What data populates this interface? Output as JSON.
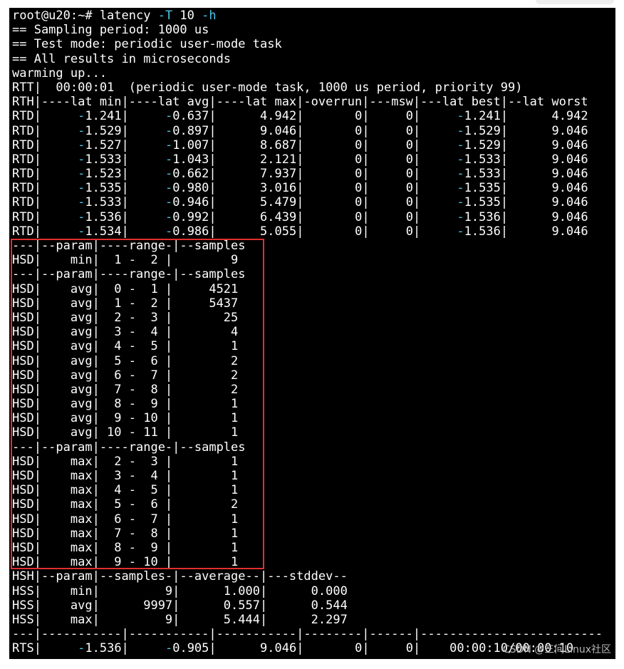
{
  "terminal": {
    "lines": [
      [
        {
          "t": "root@u20:~# latency "
        },
        {
          "t": "-T",
          "c": "cyan"
        },
        {
          "t": " 10 "
        },
        {
          "t": "-h",
          "c": "cyan"
        }
      ],
      [
        {
          "t": "== Sampling period: 1000 us"
        }
      ],
      [
        {
          "t": "== Test mode: periodic user-mode task"
        }
      ],
      [
        {
          "t": "== All results in microseconds"
        }
      ],
      [
        {
          "t": "warming up..."
        }
      ],
      [
        {
          "t": "RTT|  00:00:01  (periodic user-mode task, 1000 us period, priority 99)"
        }
      ],
      [
        {
          "t": "RTH|----lat min|----lat avg|----lat max|-overrun|---msw|---lat best|--lat worst"
        }
      ],
      [
        {
          "t": "RTD|     "
        },
        {
          "t": "-",
          "c": "cyan"
        },
        {
          "t": "1.241|     "
        },
        {
          "t": "-",
          "c": "cyan"
        },
        {
          "t": "0.637|      4.942|       0|     0|     "
        },
        {
          "t": "-",
          "c": "cyan"
        },
        {
          "t": "1.241|      4.942"
        }
      ],
      [
        {
          "t": "RTD|     "
        },
        {
          "t": "-",
          "c": "cyan"
        },
        {
          "t": "1.529|     "
        },
        {
          "t": "-",
          "c": "cyan"
        },
        {
          "t": "0.897|      9.046|       0|     0|     "
        },
        {
          "t": "-",
          "c": "cyan"
        },
        {
          "t": "1.529|      9.046"
        }
      ],
      [
        {
          "t": "RTD|     "
        },
        {
          "t": "-",
          "c": "cyan"
        },
        {
          "t": "1.527|     "
        },
        {
          "t": "-",
          "c": "cyan"
        },
        {
          "t": "1.007|      8.687|       0|     0|     "
        },
        {
          "t": "-",
          "c": "cyan"
        },
        {
          "t": "1.529|      9.046"
        }
      ],
      [
        {
          "t": "RTD|     "
        },
        {
          "t": "-",
          "c": "cyan"
        },
        {
          "t": "1.533|     "
        },
        {
          "t": "-",
          "c": "cyan"
        },
        {
          "t": "1.043|      2.121|       0|     0|     "
        },
        {
          "t": "-",
          "c": "cyan"
        },
        {
          "t": "1.533|      9.046"
        }
      ],
      [
        {
          "t": "RTD|     "
        },
        {
          "t": "-",
          "c": "cyan"
        },
        {
          "t": "1.523|     "
        },
        {
          "t": "-",
          "c": "cyan"
        },
        {
          "t": "0.662|      7.937|       0|     0|     "
        },
        {
          "t": "-",
          "c": "cyan"
        },
        {
          "t": "1.533|      9.046"
        }
      ],
      [
        {
          "t": "RTD|     "
        },
        {
          "t": "-",
          "c": "cyan"
        },
        {
          "t": "1.535|     "
        },
        {
          "t": "-",
          "c": "cyan"
        },
        {
          "t": "0.980|      3.016|       0|     0|     "
        },
        {
          "t": "-",
          "c": "cyan"
        },
        {
          "t": "1.535|      9.046"
        }
      ],
      [
        {
          "t": "RTD|     "
        },
        {
          "t": "-",
          "c": "cyan"
        },
        {
          "t": "1.533|     "
        },
        {
          "t": "-",
          "c": "cyan"
        },
        {
          "t": "0.946|      5.479|       0|     0|     "
        },
        {
          "t": "-",
          "c": "cyan"
        },
        {
          "t": "1.535|      9.046"
        }
      ],
      [
        {
          "t": "RTD|     "
        },
        {
          "t": "-",
          "c": "cyan"
        },
        {
          "t": "1.536|     "
        },
        {
          "t": "-",
          "c": "cyan"
        },
        {
          "t": "0.992|      6.439|       0|     0|     "
        },
        {
          "t": "-",
          "c": "cyan"
        },
        {
          "t": "1.536|      9.046"
        }
      ],
      [
        {
          "t": "RTD|     "
        },
        {
          "t": "-",
          "c": "cyan"
        },
        {
          "t": "1.534|     "
        },
        {
          "t": "-",
          "c": "cyan"
        },
        {
          "t": "0.986|      5.055|       0|     0|     "
        },
        {
          "t": "-",
          "c": "cyan"
        },
        {
          "t": "1.536|      9.046"
        }
      ],
      [
        {
          "t": "---|--param|----range-|--samples"
        }
      ],
      [
        {
          "t": "HSD|    min|  1 -  2 |        9"
        }
      ],
      [
        {
          "t": "---|--param|----range-|--samples"
        }
      ],
      [
        {
          "t": "HSD|    avg|  0 -  1 |     4521"
        }
      ],
      [
        {
          "t": "HSD|    avg|  1 -  2 |     5437"
        }
      ],
      [
        {
          "t": "HSD|    avg|  2 -  3 |       25"
        }
      ],
      [
        {
          "t": "HSD|    avg|  3 -  4 |        4"
        }
      ],
      [
        {
          "t": "HSD|    avg|  4 -  5 |        1"
        }
      ],
      [
        {
          "t": "HSD|    avg|  5 -  6 |        2"
        }
      ],
      [
        {
          "t": "HSD|    avg|  6 -  7 |        2"
        }
      ],
      [
        {
          "t": "HSD|    avg|  7 -  8 |        2"
        }
      ],
      [
        {
          "t": "HSD|    avg|  8 -  9 |        1"
        }
      ],
      [
        {
          "t": "HSD|    avg|  9 - 10 |        1"
        }
      ],
      [
        {
          "t": "HSD|    avg| 10 - 11 |        1"
        }
      ],
      [
        {
          "t": "---|--param|----range-|--samples"
        }
      ],
      [
        {
          "t": "HSD|    max|  2 -  3 |        1"
        }
      ],
      [
        {
          "t": "HSD|    max|  3 -  4 |        1"
        }
      ],
      [
        {
          "t": "HSD|    max|  4 -  5 |        1"
        }
      ],
      [
        {
          "t": "HSD|    max|  5 -  6 |        2"
        }
      ],
      [
        {
          "t": "HSD|    max|  6 -  7 |        1"
        }
      ],
      [
        {
          "t": "HSD|    max|  7 -  8 |        1"
        }
      ],
      [
        {
          "t": "HSD|    max|  8 -  9 |        1"
        }
      ],
      [
        {
          "t": "HSD|    max|  9 - 10 |        1"
        }
      ],
      [
        {
          "t": "HSH|--param|--samples-|--average--|---stddev--"
        }
      ],
      [
        {
          "t": "HSS|    min|         9|      1.000|      0.000"
        }
      ],
      [
        {
          "t": "HSS|    avg|      9997|      0.557|      0.544"
        }
      ],
      [
        {
          "t": "HSS|    max|         9|      5.444|      2.297"
        }
      ],
      [
        {
          "t": "---|-----------|-----------|-----------|--------|------|-------------------------"
        }
      ],
      [
        {
          "t": "RTS|     "
        },
        {
          "t": "-",
          "c": "cyan"
        },
        {
          "t": "1.536|     "
        },
        {
          "t": "-",
          "c": "cyan"
        },
        {
          "t": "0.905|      9.046|       0|     0|    00:00:10/00:00:10"
        }
      ]
    ]
  },
  "watermark": "CSDN @三间Linux社区",
  "colors": {
    "background": "#000000",
    "foreground": "#ffffff",
    "accent": "#4fc3e6",
    "highlight_box": "#e03030"
  }
}
